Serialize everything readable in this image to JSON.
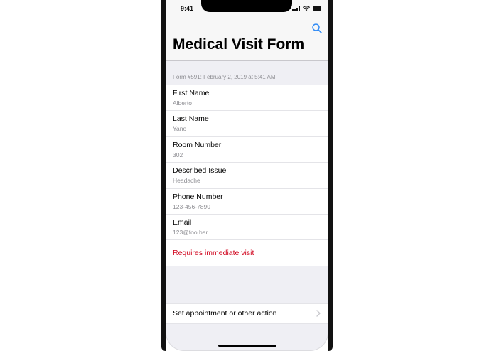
{
  "status_bar": {
    "time": "9:41"
  },
  "nav": {
    "title": "Medical Visit Form",
    "search_icon": "search-icon"
  },
  "form": {
    "header": "Form #591: February 2, 2019 at 5:41 AM",
    "fields": [
      {
        "label": "First Name",
        "value": "Alberto"
      },
      {
        "label": "Last Name",
        "value": "Yano"
      },
      {
        "label": "Room Number",
        "value": "302"
      },
      {
        "label": "Described Issue",
        "value": "Headache"
      },
      {
        "label": "Phone Number",
        "value": "123-456-7890"
      },
      {
        "label": "Email",
        "value": "123@foo.bar"
      }
    ],
    "alert": "Requires immediate visit"
  },
  "action": {
    "label": "Set appointment or other action",
    "chevron_icon": "chevron-right-icon"
  },
  "colors": {
    "accent": "#2f8af5",
    "alert": "#d0021b",
    "secondary_text": "#8e8e93",
    "background": "#efeff4"
  }
}
